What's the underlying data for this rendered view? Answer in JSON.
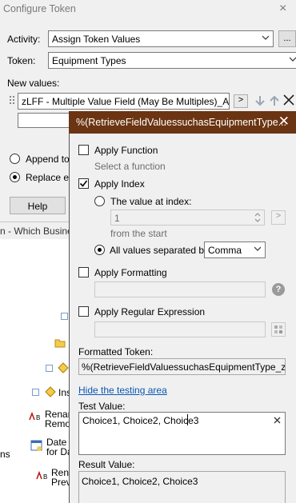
{
  "window": {
    "title": "Configure Token",
    "close_glyph": "×"
  },
  "form": {
    "activity_label": "Activity:",
    "activity_value": "Assign Token Values",
    "ellipsis_label": "...",
    "token_label": "Token:",
    "token_value": "Equipment Types",
    "new_values_label": "New values:",
    "new_value_text": "zLFF - Multiple Value Field (May Be Multiples)_All#[, ]#)",
    "append_label": "Append to e",
    "replace_label": "Replace ex",
    "help_label": "Help",
    "tree_header": "n - Which Busines"
  },
  "tree": {
    "items": [
      {
        "label": "Ins"
      },
      {
        "label": "Renan"
      },
      {
        "label": "Remov"
      },
      {
        "label": "Date"
      },
      {
        "label": "for Da"
      },
      {
        "label": "Rena"
      },
      {
        "label": "Prev"
      },
      {
        "label": "ns"
      }
    ]
  },
  "popup": {
    "title": "%(RetrieveFieldValuessuchasEquipmentType...",
    "close_glyph": "✕",
    "apply_function_label": "Apply Function",
    "select_function_label": "Select a function",
    "apply_index_label": "Apply Index",
    "value_at_index_label": "The value at index:",
    "index_value": "1",
    "from_start_label": "from the  start",
    "all_values_label": "All values separated by:",
    "separator_value": "Comma",
    "apply_formatting_label": "Apply Formatting",
    "apply_regex_label": "Apply Regular Expression",
    "formatted_token_label": "Formatted Token:",
    "formatted_token_value": "%(RetrieveFieldValuessuchasEquipmentType_zLFF - M",
    "hide_testing_link": "Hide the testing area",
    "test_value_label": "Test Value:",
    "test_value": "Choice1, Choice2, Choice3",
    "result_value_label": "Result Value:",
    "result_value": "Choice1, Choice2, Choice3",
    "help_glyph": "?",
    "small_button_glyph": ">"
  },
  "colors": {
    "popup_title_bg": "#6b3412",
    "link": "#0a57b5"
  }
}
